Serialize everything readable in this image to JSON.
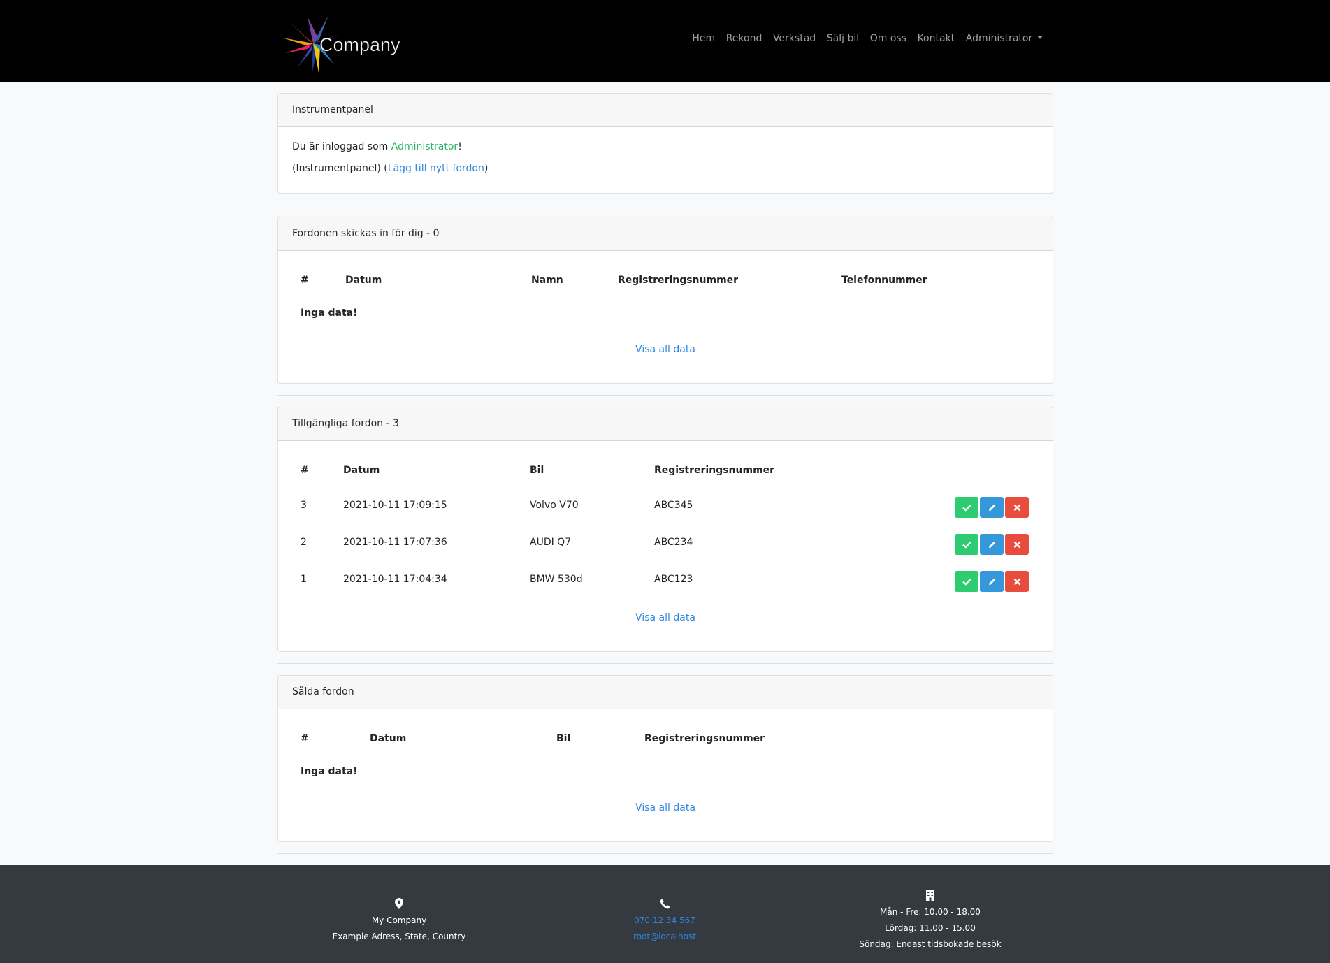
{
  "logo": {
    "text": "Company"
  },
  "nav": {
    "items": [
      "Hem",
      "Rekond",
      "Verkstad",
      "Sälj bil",
      "Om oss",
      "Kontakt"
    ],
    "admin": "Administrator"
  },
  "dashboard": {
    "title": "Instrumentpanel",
    "logged_prefix": "Du är inloggad som ",
    "logged_role": "Administrator",
    "logged_suffix": "!",
    "link_current": "(Instrumentpanel) (",
    "link_add": "Lägg till nytt fordon",
    "link_close": ")"
  },
  "submitted": {
    "title": "Fordonen skickas in för dig - 0",
    "headers": [
      "#",
      "Datum",
      "Namn",
      "Registreringsnummer",
      "Telefonnummer"
    ],
    "empty": "Inga data!",
    "view_all": "Visa all data"
  },
  "available": {
    "title": "Tillgängliga fordon - 3",
    "headers": [
      "#",
      "Datum",
      "Bil",
      "Registreringsnummer"
    ],
    "rows": [
      {
        "id": "3",
        "date": "2021-10-11 17:09:15",
        "car": "Volvo V70",
        "reg": "ABC345"
      },
      {
        "id": "2",
        "date": "2021-10-11 17:07:36",
        "car": "AUDI Q7",
        "reg": "ABC234"
      },
      {
        "id": "1",
        "date": "2021-10-11 17:04:34",
        "car": "BMW 530d",
        "reg": "ABC123"
      }
    ],
    "view_all": "Visa all data"
  },
  "sold": {
    "title": "Sålda fordon",
    "headers": [
      "#",
      "Datum",
      "Bil",
      "Registreringsnummer"
    ],
    "empty": "Inga data!",
    "view_all": "Visa all data"
  },
  "footer": {
    "company": "My Company",
    "address": "Example Adress, State, Country",
    "phone": "070 12 34 567",
    "email": "root@localhost",
    "hours_weekday": "Mån - Fre: 10.00 - 18.00",
    "hours_saturday": "Lördag: 11.00 - 15.00",
    "hours_sunday": "Söndag: Endast tidsbokade besök"
  },
  "colors": {
    "navbar": "#000000",
    "footer": "#343a40",
    "success": "#2ecc71",
    "primary": "#3498db",
    "danger": "#e74c3c",
    "link": "#2e86de"
  }
}
